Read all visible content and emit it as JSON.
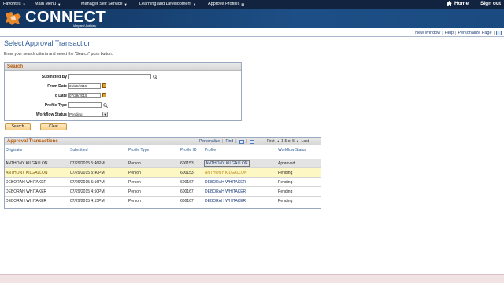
{
  "topnav": {
    "items": [
      {
        "label": "Favorites"
      },
      {
        "label": "Main Menu"
      },
      {
        "label": "Manager Self Service"
      },
      {
        "label": "Learning and Development"
      },
      {
        "label": "Approve Profiles"
      }
    ],
    "home_label": "Home",
    "signout_label": "Sign out"
  },
  "banner": {
    "logo_text": "CONNECT",
    "logo_sub": "Maryland Judiciary"
  },
  "header_links": {
    "new_window": "New Window",
    "help": "Help",
    "personalize_page": "Personalize Page"
  },
  "page": {
    "title": "Select Approval Transaction",
    "instructions": "Enter your search criteria and select the \"Search\" push button."
  },
  "search": {
    "panel_title": "Search",
    "submitted_by_label": "Submitted By",
    "submitted_by_value": "",
    "from_date_label": "From Date",
    "from_date_value": "06/29/2015",
    "to_date_label": "To Date",
    "to_date_value": "07/29/2015",
    "profile_type_label": "Profile Type",
    "profile_type_value": "",
    "workflow_status_label": "Workflow Status",
    "workflow_status_value": "Pending",
    "search_button": "Search",
    "clear_button": "Clear"
  },
  "grid": {
    "title": "Approval Transactions",
    "personalize": "Personalize",
    "find": "Find",
    "first": "First",
    "range": "1-5 of 5",
    "last": "Last",
    "columns": [
      "Originator",
      "Submitted",
      "Profile Type",
      "Profile ID",
      "Profile",
      "Workflow Status"
    ],
    "rows": [
      {
        "originator": "ANTHONY KILGALLON",
        "submitted": "07/29/2015  5:46PM",
        "type": "Person",
        "id": "600153",
        "profile": "ANTHONY KILGALLON",
        "status": "Approved"
      },
      {
        "originator": "ANTHONY KILGALLON",
        "submitted": "07/29/2015  5:40PM",
        "type": "Person",
        "id": "600153",
        "profile": "ANTHONY KILGALLON",
        "status": "Pending"
      },
      {
        "originator": "DEBORAH WHITAKER",
        "submitted": "07/29/2015  5:16PM",
        "type": "Person",
        "id": "600167",
        "profile": "DEBORAH WHITAKER",
        "status": "Pending"
      },
      {
        "originator": "DEBORAH WHITAKER",
        "submitted": "07/29/2015  4:50PM",
        "type": "Person",
        "id": "600167",
        "profile": "DEBORAH WHITAKER",
        "status": "Pending"
      },
      {
        "originator": "DEBORAH WHITAKER",
        "submitted": "07/29/2015  4:15PM",
        "type": "Person",
        "id": "600167",
        "profile": "DEBORAH WHITAKER",
        "status": "Pending"
      }
    ]
  },
  "colors": {
    "nav_bg": "#11233f",
    "banner_bg": "#1d4f86",
    "title_blue": "#2b5b95",
    "section_orange": "#b55a0c",
    "row_hover": "#e3e3e3",
    "row_selected": "#fdf7c4"
  }
}
